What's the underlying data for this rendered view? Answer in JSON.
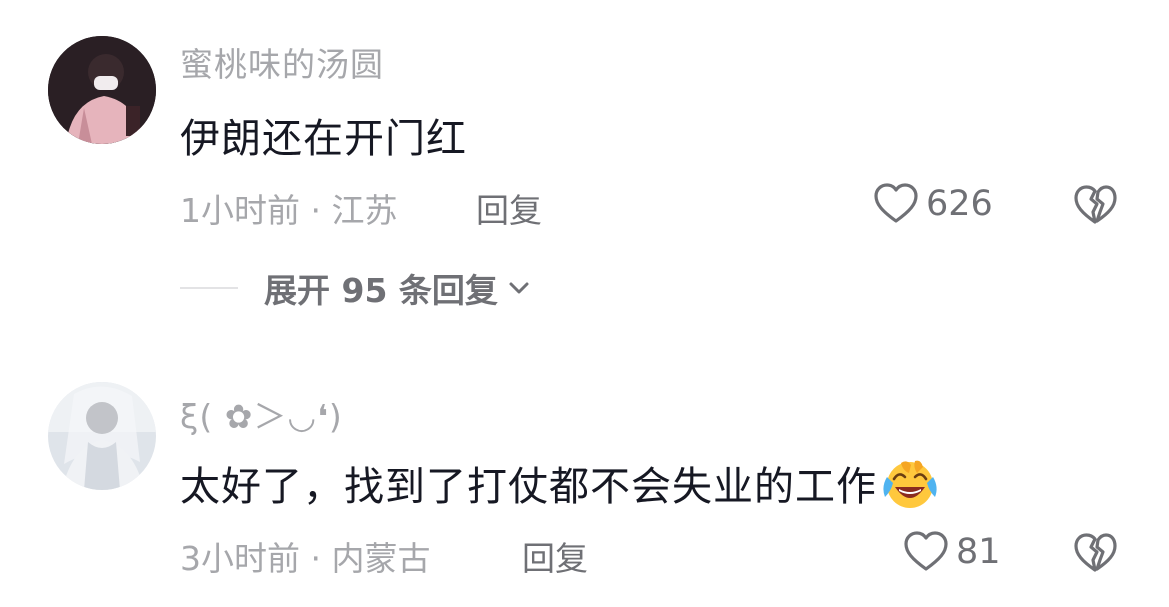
{
  "comments": [
    {
      "username": "蜜桃味的汤圆",
      "text": "伊朗还在开门红",
      "time_location": "1小时前 · 江苏",
      "reply_label": "回复",
      "likes": "626",
      "expand_label": "展开 95 条回复"
    },
    {
      "username": "ξ( ✿＞◡❛)",
      "text": "太好了，找到了打仗都不会失业的工作",
      "emoji": "laughing-crying-emoji",
      "time_location": "3小时前 · 内蒙古",
      "reply_label": "回复",
      "likes": "81"
    }
  ],
  "icons": {
    "like": "heart-outline-icon",
    "dislike": "broken-heart-icon",
    "expand": "chevron-down-icon"
  },
  "colors": {
    "primary_text": "#161823",
    "secondary_text": "#a6a7ab",
    "action_text": "#6f7075",
    "divider": "#e3e3e5"
  }
}
